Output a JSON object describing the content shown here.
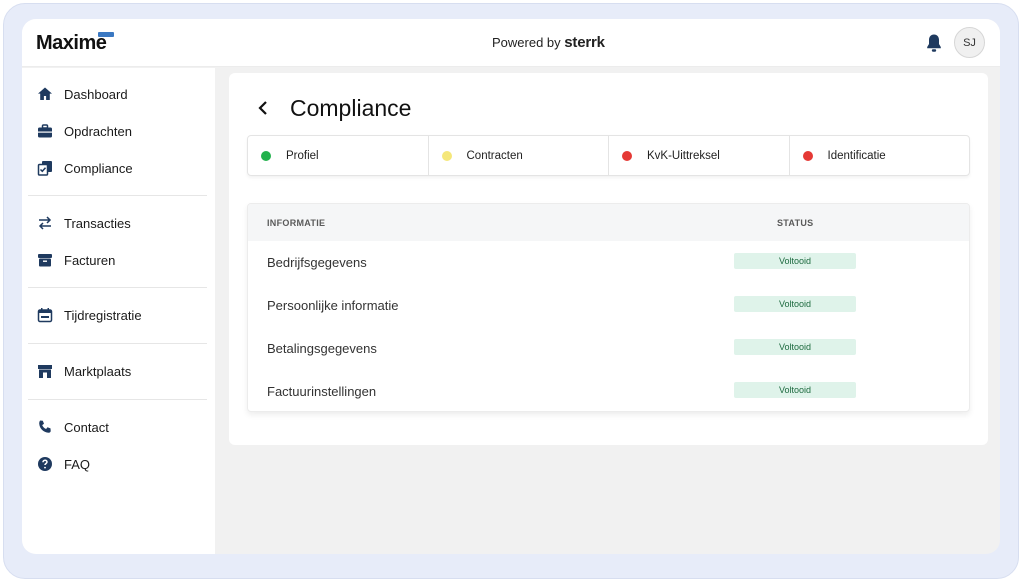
{
  "header": {
    "logo": "Maxime",
    "powered_prefix": "Powered by",
    "powered_brand": "sterrk",
    "avatar_initials": "SJ"
  },
  "sidebar": {
    "items": [
      {
        "label": "Dashboard",
        "icon": "home-icon"
      },
      {
        "label": "Opdrachten",
        "icon": "briefcase-icon"
      },
      {
        "label": "Compliance",
        "icon": "compliance-icon"
      },
      {
        "label": "Transacties",
        "icon": "transfer-icon"
      },
      {
        "label": "Facturen",
        "icon": "archive-icon"
      },
      {
        "label": "Tijdregistratie",
        "icon": "calendar-icon"
      },
      {
        "label": "Marktplaats",
        "icon": "store-icon"
      },
      {
        "label": "Contact",
        "icon": "phone-icon"
      },
      {
        "label": "FAQ",
        "icon": "help-icon"
      }
    ]
  },
  "page": {
    "title": "Compliance",
    "steps": [
      {
        "label": "Profiel",
        "color": "#22b14c"
      },
      {
        "label": "Contracten",
        "color": "#f5e77a"
      },
      {
        "label": "KvK-Uittreksel",
        "color": "#e53935"
      },
      {
        "label": "Identificatie",
        "color": "#e53935"
      }
    ],
    "table": {
      "col_info": "INFORMATIE",
      "col_status": "STATUS",
      "rows": [
        {
          "label": "Bedrijfsgegevens",
          "status": "Voltooid"
        },
        {
          "label": "Persoonlijke informatie",
          "status": "Voltooid"
        },
        {
          "label": "Betalingsgegevens",
          "status": "Voltooid"
        },
        {
          "label": "Factuurinstellingen",
          "status": "Voltooid"
        }
      ]
    }
  },
  "colors": {
    "accent": "#1f3a5f",
    "status_done_bg": "#dff3ea"
  }
}
